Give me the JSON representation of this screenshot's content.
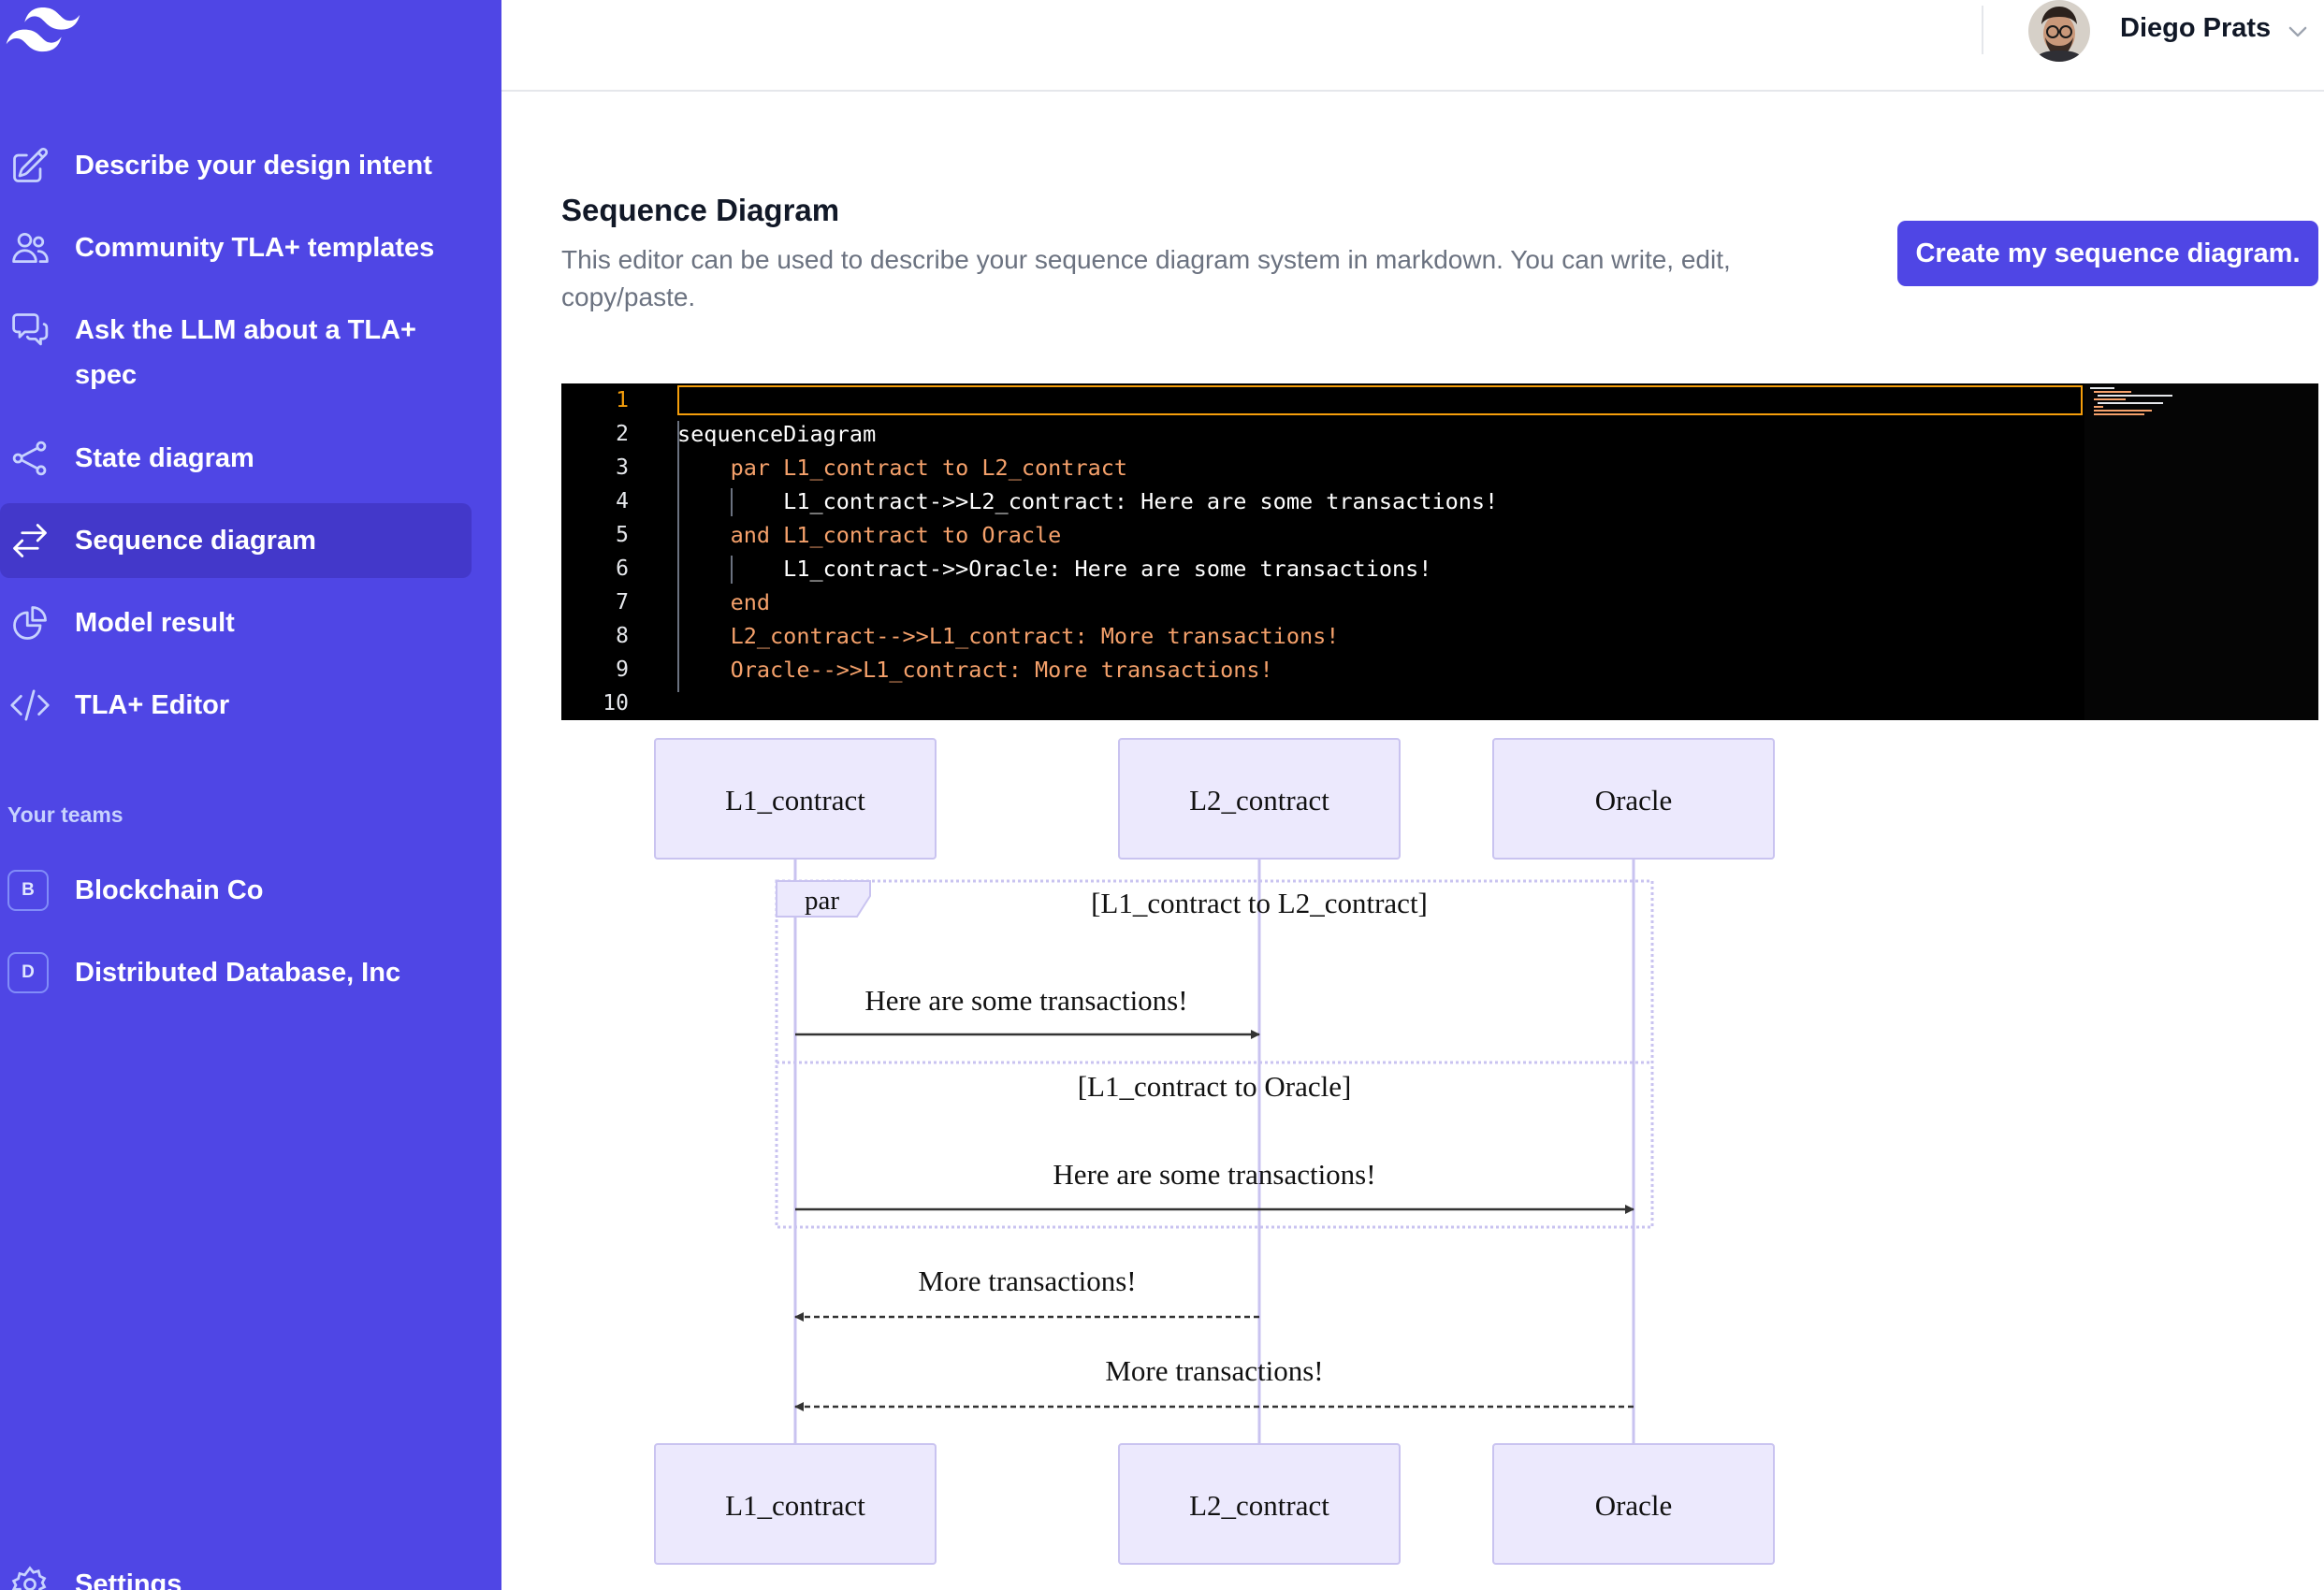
{
  "sidebar": {
    "logo": "tailwind-logo",
    "nav": [
      {
        "label": "Describe your design intent",
        "icon": "pencil-square-icon",
        "active": false
      },
      {
        "label": "Community TLA+ templates",
        "icon": "users-icon",
        "active": false
      },
      {
        "label": "Ask the LLM about a TLA+ spec",
        "icon": "chat-bubbles-icon",
        "active": false
      },
      {
        "label": "State diagram",
        "icon": "share-icon",
        "active": false
      },
      {
        "label": "Sequence diagram",
        "icon": "arrows-right-left-icon",
        "active": true
      },
      {
        "label": "Model result",
        "icon": "chart-pie-icon",
        "active": false
      },
      {
        "label": "TLA+ Editor",
        "icon": "code-bracket-icon",
        "active": false
      }
    ],
    "teams_heading": "Your teams",
    "teams": [
      {
        "initial": "B",
        "name": "Blockchain Co"
      },
      {
        "initial": "D",
        "name": "Distributed Database, Inc"
      }
    ],
    "settings_label": "Settings"
  },
  "header": {
    "user_name": "Diego Prats",
    "avatar": "user-avatar",
    "menu_icon": "chevron-down-icon"
  },
  "main": {
    "title": "Sequence Diagram",
    "description": "This editor can be used to describe your sequence diagram system in markdown. You can write, edit, copy/paste.",
    "create_button": "Create my sequence diagram."
  },
  "editor": {
    "current_line": 1,
    "lines": [
      "",
      "sequenceDiagram",
      "    par L1_contract to L2_contract",
      "        L1_contract->>L2_contract: Here are some transactions!",
      "    and L1_contract to Oracle",
      "        L1_contract->>Oracle: Here are some transactions!",
      "    end",
      "    L2_contract-->>L1_contract: More transactions!",
      "    Oracle-->>L1_contract: More transactions!",
      ""
    ],
    "line_numbers": [
      "1",
      "2",
      "3",
      "4",
      "5",
      "6",
      "7",
      "8",
      "9",
      "10"
    ]
  },
  "diagram": {
    "participants": [
      "L1_contract",
      "L2_contract",
      "Oracle"
    ],
    "par_label": "par",
    "par_section_1": "[L1_contract to L2_contract]",
    "par_section_2": "[L1_contract to Oracle]",
    "messages": [
      {
        "from": "L1_contract",
        "to": "L2_contract",
        "text": "Here are some transactions!",
        "style": "solid"
      },
      {
        "from": "L1_contract",
        "to": "Oracle",
        "text": "Here are some transactions!",
        "style": "solid"
      },
      {
        "from": "L2_contract",
        "to": "L1_contract",
        "text": "More transactions!",
        "style": "dashed"
      },
      {
        "from": "Oracle",
        "to": "L1_contract",
        "text": "More transactions!",
        "style": "dashed"
      }
    ]
  }
}
